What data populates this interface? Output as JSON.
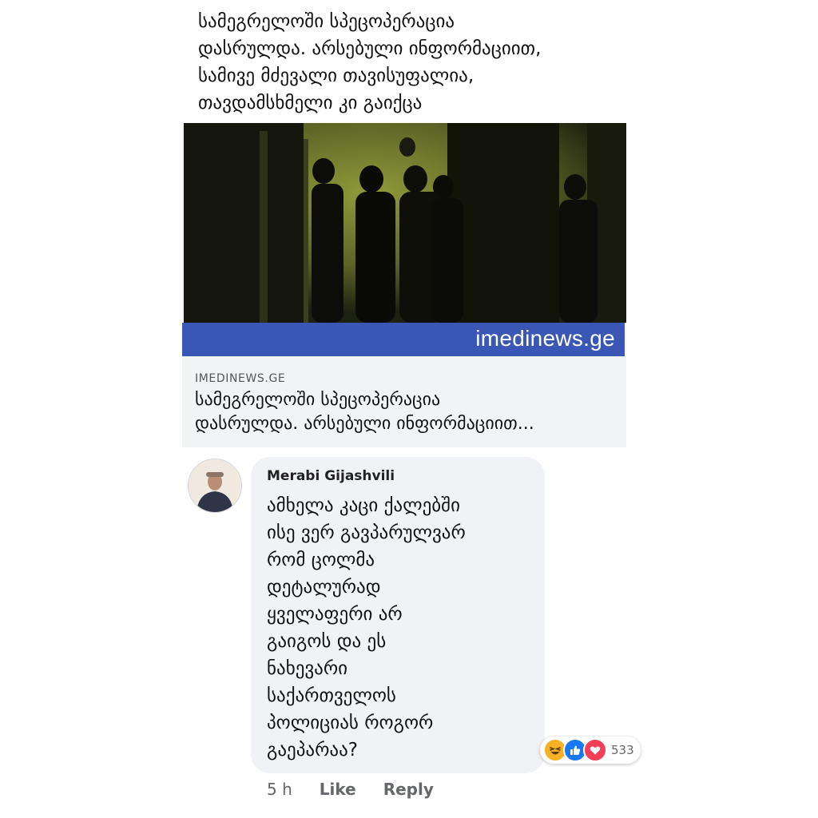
{
  "post": {
    "text_lines": [
      "სამეგრელოში სპეცოპერაცია",
      "დასრულდა. არსებული ინფორმაციით,",
      "სამივე მძევალი თავისუფალია,",
      "თავდამსხმელი კი გაიქცა"
    ]
  },
  "link_card": {
    "watermark": "imedinews.ge",
    "domain": "IMEDINEWS.GE",
    "title_lines": [
      "სამეგრელოში სპეცოპერაცია",
      "დასრულდა. არსებული ინფორმაციით..."
    ]
  },
  "comment": {
    "author": "Merabi Gijashvili",
    "text_lines": [
      "ამხელა კაცი ქალებში",
      "ისე ვერ გავპარულვარ",
      "რომ ცოლმა",
      "დეტალურად",
      "ყველაფერი არ",
      "გაიგოს და ეს",
      "ნახევარი",
      "საქართველოს",
      "პოლიციას როგორ",
      "გაეპარაა?"
    ],
    "reaction_count": "533",
    "reactions": [
      "haha-icon",
      "like-icon",
      "love-icon"
    ],
    "timestamp": "5 h",
    "like_label": "Like",
    "reply_label": "Reply"
  },
  "colors": {
    "brand_band": "#3a57b5",
    "bubble": "#f0f2f5",
    "like": "#1877f2",
    "love": "#f33e58",
    "haha": "#f7b125"
  }
}
